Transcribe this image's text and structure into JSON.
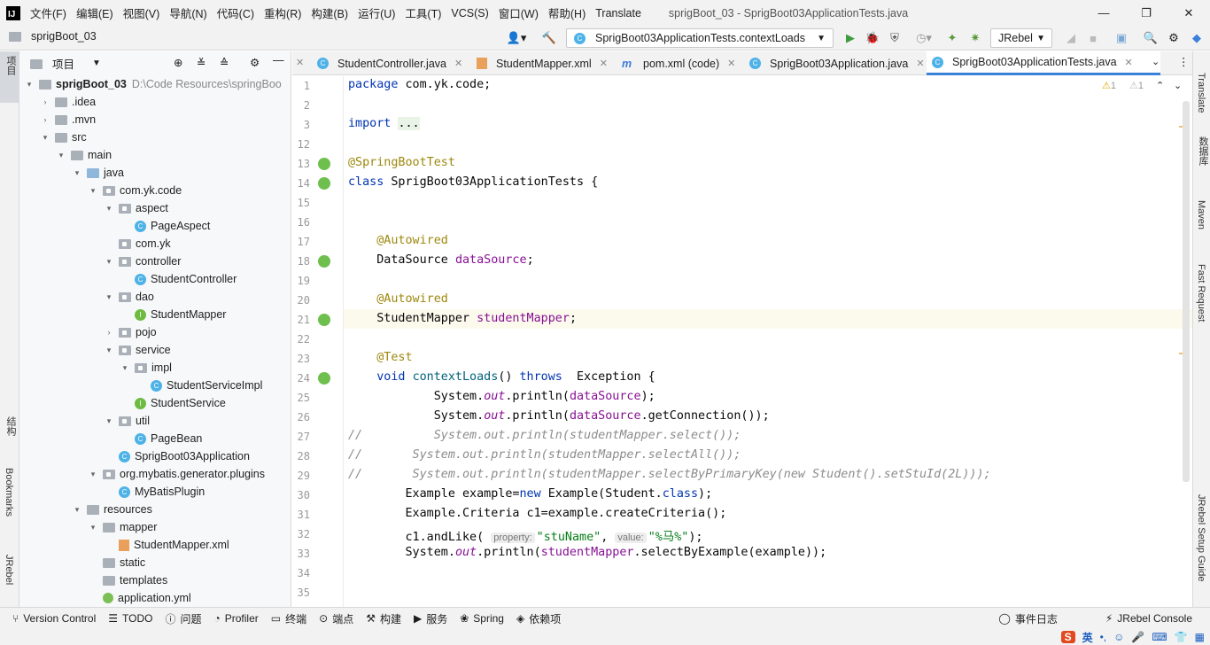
{
  "menubar": {
    "logo": "IJ",
    "items": [
      "文件(F)",
      "编辑(E)",
      "视图(V)",
      "导航(N)",
      "代码(C)",
      "重构(R)",
      "构建(B)",
      "运行(U)",
      "工具(T)",
      "VCS(S)",
      "窗口(W)",
      "帮助(H)",
      "Translate"
    ],
    "window_title": "sprigBoot_03 - SprigBoot03ApplicationTests.java"
  },
  "navbar": {
    "project": "sprigBoot_03",
    "run_config": "SprigBoot03ApplicationTests.contextLoads",
    "jrebel": "JRebel"
  },
  "project_panel": {
    "title": "项目",
    "tree": [
      {
        "label": "sprigBoot_03",
        "path": "D:\\Code Resources\\springBoo",
        "depth": 0,
        "arrow": "▾",
        "icon": "folder-bold"
      },
      {
        "label": ".idea",
        "depth": 1,
        "arrow": "›",
        "icon": "folder"
      },
      {
        "label": ".mvn",
        "depth": 1,
        "arrow": "›",
        "icon": "folder"
      },
      {
        "label": "src",
        "depth": 1,
        "arrow": "▾",
        "icon": "folder"
      },
      {
        "label": "main",
        "depth": 2,
        "arrow": "▾",
        "icon": "folder"
      },
      {
        "label": "java",
        "depth": 3,
        "arrow": "▾",
        "icon": "folder-blue"
      },
      {
        "label": "com.yk.code",
        "depth": 4,
        "arrow": "▾",
        "icon": "package"
      },
      {
        "label": "aspect",
        "depth": 5,
        "arrow": "▾",
        "icon": "package"
      },
      {
        "label": "PageAspect",
        "depth": 6,
        "arrow": "",
        "icon": "class"
      },
      {
        "label": "com.yk",
        "depth": 5,
        "arrow": "",
        "icon": "package"
      },
      {
        "label": "controller",
        "depth": 5,
        "arrow": "▾",
        "icon": "package"
      },
      {
        "label": "StudentController",
        "depth": 6,
        "arrow": "",
        "icon": "class"
      },
      {
        "label": "dao",
        "depth": 5,
        "arrow": "▾",
        "icon": "package"
      },
      {
        "label": "StudentMapper",
        "depth": 6,
        "arrow": "",
        "icon": "interface"
      },
      {
        "label": "pojo",
        "depth": 5,
        "arrow": "›",
        "icon": "package"
      },
      {
        "label": "service",
        "depth": 5,
        "arrow": "▾",
        "icon": "package"
      },
      {
        "label": "impl",
        "depth": 6,
        "arrow": "▾",
        "icon": "package"
      },
      {
        "label": "StudentServiceImpl",
        "depth": 7,
        "arrow": "",
        "icon": "class"
      },
      {
        "label": "StudentService",
        "depth": 6,
        "arrow": "",
        "icon": "interface"
      },
      {
        "label": "util",
        "depth": 5,
        "arrow": "▾",
        "icon": "package"
      },
      {
        "label": "PageBean",
        "depth": 6,
        "arrow": "",
        "icon": "class"
      },
      {
        "label": "SprigBoot03Application",
        "depth": 5,
        "arrow": "",
        "icon": "class"
      },
      {
        "label": "org.mybatis.generator.plugins",
        "depth": 4,
        "arrow": "▾",
        "icon": "package"
      },
      {
        "label": "MyBatisPlugin",
        "depth": 5,
        "arrow": "",
        "icon": "class"
      },
      {
        "label": "resources",
        "depth": 3,
        "arrow": "▾",
        "icon": "folder"
      },
      {
        "label": "mapper",
        "depth": 4,
        "arrow": "▾",
        "icon": "folder"
      },
      {
        "label": "StudentMapper.xml",
        "depth": 5,
        "arrow": "",
        "icon": "xml"
      },
      {
        "label": "static",
        "depth": 4,
        "arrow": "",
        "icon": "folder"
      },
      {
        "label": "templates",
        "depth": 4,
        "arrow": "",
        "icon": "folder"
      },
      {
        "label": "application.yml",
        "depth": 4,
        "arrow": "",
        "icon": "yml"
      }
    ]
  },
  "tabs": [
    {
      "label": "StudentController.java",
      "icon": "class"
    },
    {
      "label": "StudentMapper.xml",
      "icon": "xml"
    },
    {
      "label": "pom.xml (code)",
      "icon": "maven"
    },
    {
      "label": "SprigBoot03Application.java",
      "icon": "class"
    },
    {
      "label": "SprigBoot03ApplicationTests.java",
      "icon": "class",
      "active": true
    }
  ],
  "inspections": {
    "warn1": "1",
    "warn2": "1"
  },
  "left_strip": {
    "project": "项目",
    "structure": "结构",
    "bookmarks": "Bookmarks",
    "jrebel": "JRebel"
  },
  "right_strip": {
    "translate": "Translate",
    "database": "数据库",
    "maven": "Maven",
    "fast_request": "Fast Request",
    "jrebel_setup": "JRebel Setup Guide"
  },
  "code_lines": [
    {
      "n": "1",
      "html": "<span class='kw'>package</span> com.yk.code;"
    },
    {
      "n": "2",
      "html": ""
    },
    {
      "n": "3",
      "html": "<span class='kw'>import</span> <span style='background:#e9f3e6'>...</span>"
    },
    {
      "n": "12",
      "html": ""
    },
    {
      "n": "13",
      "html": "<span class='an'>@SpringBootTest</span>"
    },
    {
      "n": "14",
      "html": "<span class='kw'>class</span> SprigBoot03ApplicationTests {"
    },
    {
      "n": "15",
      "html": ""
    },
    {
      "n": "16",
      "html": ""
    },
    {
      "n": "17",
      "html": "    <span class='an'>@Autowired</span>"
    },
    {
      "n": "18",
      "html": "    DataSource <span class='fd'>dataSource</span>;"
    },
    {
      "n": "19",
      "html": ""
    },
    {
      "n": "20",
      "html": "    <span class='an'>@Autowired</span>"
    },
    {
      "n": "21",
      "html": "    StudentMapper <span class='fd'>studentMapper</span>;"
    },
    {
      "n": "22",
      "html": ""
    },
    {
      "n": "23",
      "html": "    <span class='an'>@Test</span>"
    },
    {
      "n": "24",
      "html": "    <span class='kw'>void</span> <span style='color:#00627a'>contextLoads</span>() <span class='kw'>throws</span>  Exception {"
    },
    {
      "n": "25",
      "html": "            System.<span class='fd it'>out</span>.println(<span class='fd'>dataSource</span>);"
    },
    {
      "n": "26",
      "html": "            System.<span class='fd it'>out</span>.println(<span class='fd'>dataSource</span>.getConnection());"
    },
    {
      "n": "27",
      "html": "<span class='cm'>//          System.out.println(studentMapper.select());</span>"
    },
    {
      "n": "28",
      "html": "<span class='cm'>//       System.out.println(studentMapper.selectAll());</span>"
    },
    {
      "n": "29",
      "html": "<span class='cm'>//       System.out.println(studentMapper.selectByPrimaryKey(new Student().setStuId(2L)));</span>"
    },
    {
      "n": "30",
      "html": "        Example example=<span class='kw'>new</span> Example(Student.<span class='kw'>class</span>);"
    },
    {
      "n": "31",
      "html": "        Example.Criteria c1=example.createCriteria();"
    },
    {
      "n": "32",
      "html": "        c1.andLike( <span class='hint'>property:</span><span class='st'>\"stuName\"</span>, <span class='hint'>value:</span><span class='st'>\"%马%\"</span>);"
    },
    {
      "n": "33",
      "html": "        System.<span class='fd it'>out</span>.println(<span class='fd'>studentMapper</span>.selectByExample(example));"
    },
    {
      "n": "34",
      "html": ""
    },
    {
      "n": "35",
      "html": ""
    }
  ],
  "statusbar": {
    "items": [
      "Version Control",
      "TODO",
      "问题",
      "Profiler",
      "终端",
      "端点",
      "构建",
      "服务",
      "Spring",
      "依赖项"
    ],
    "right": [
      "事件日志",
      "JRebel Console"
    ]
  },
  "taskbar": {
    "ime": "英"
  }
}
